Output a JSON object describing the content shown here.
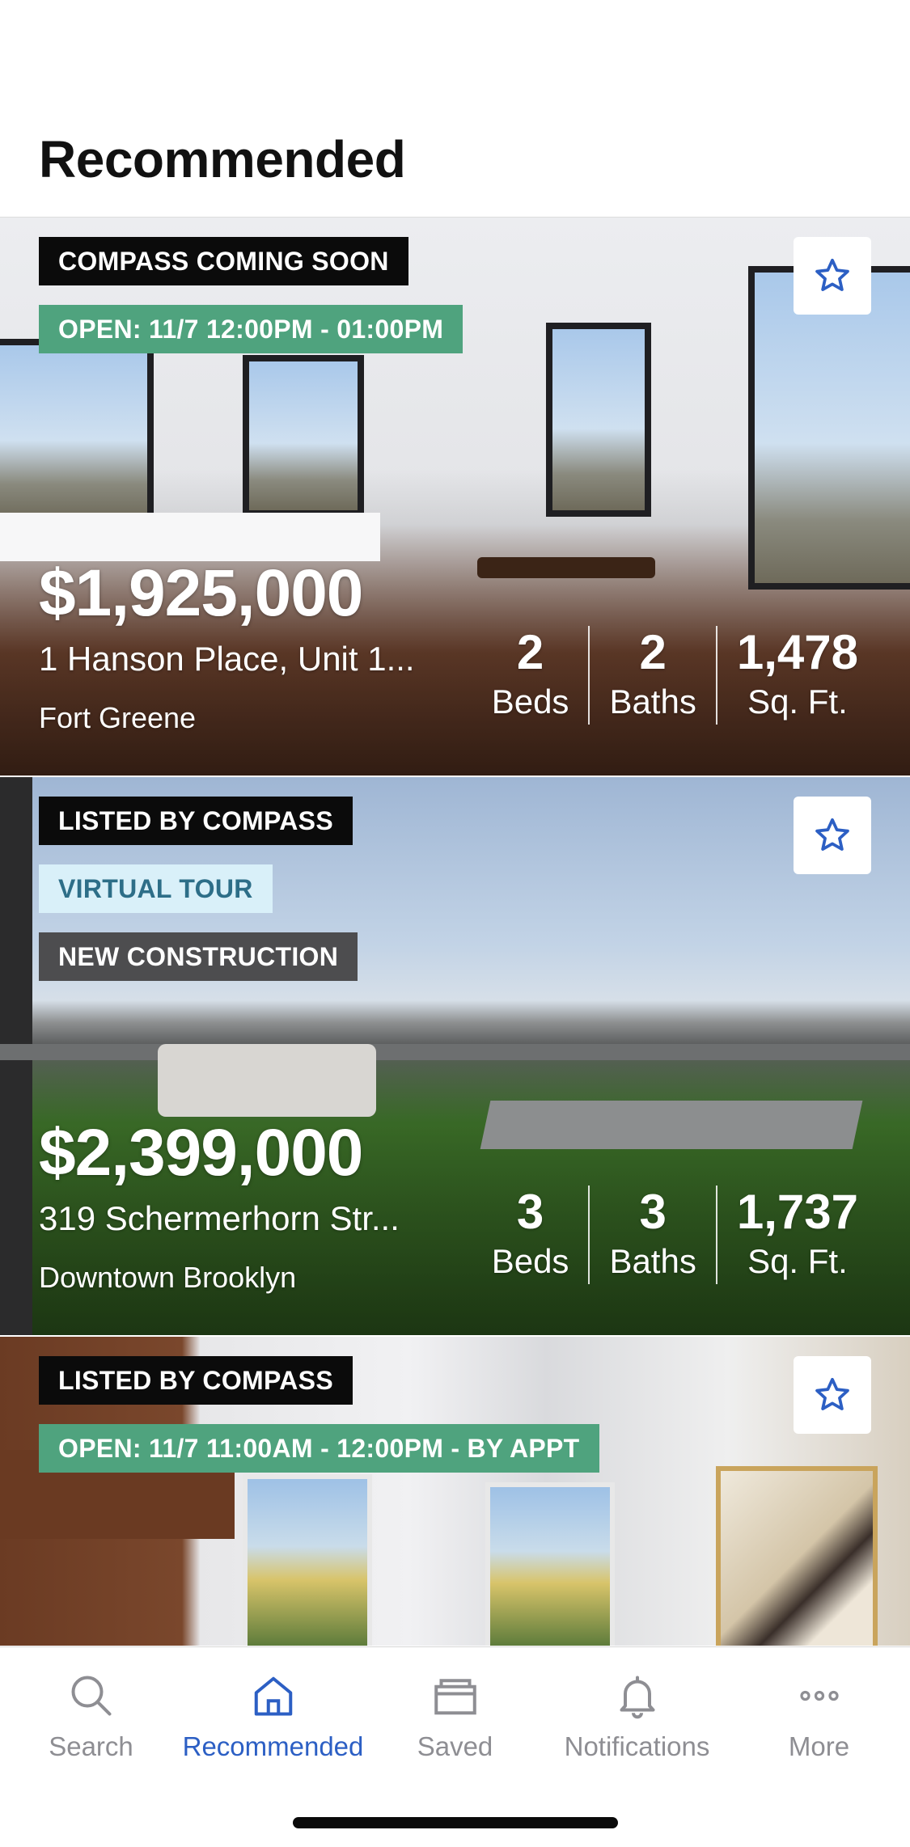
{
  "page": {
    "title": "Recommended"
  },
  "listings": [
    {
      "tags": [
        {
          "text": "COMPASS COMING SOON",
          "style": "black"
        },
        {
          "text": "OPEN: 11/7 12:00PM - 01:00PM",
          "style": "green"
        }
      ],
      "price": "$1,925,000",
      "address": "1 Hanson Place, Unit 1...",
      "neighborhood": "Fort Greene",
      "beds": "2",
      "beds_label": "Beds",
      "baths": "2",
      "baths_label": "Baths",
      "sqft": "1,478",
      "sqft_label": "Sq. Ft.",
      "favorite_icon": "star-outline-icon"
    },
    {
      "tags": [
        {
          "text": "LISTED BY COMPASS",
          "style": "black"
        },
        {
          "text": "VIRTUAL TOUR",
          "style": "lightblue"
        },
        {
          "text": "NEW CONSTRUCTION",
          "style": "grey"
        }
      ],
      "price": "$2,399,000",
      "address": "319 Schermerhorn Str...",
      "neighborhood": "Downtown Brooklyn",
      "beds": "3",
      "beds_label": "Beds",
      "baths": "3",
      "baths_label": "Baths",
      "sqft": "1,737",
      "sqft_label": "Sq. Ft.",
      "favorite_icon": "star-outline-icon"
    },
    {
      "tags": [
        {
          "text": "LISTED BY COMPASS",
          "style": "black"
        },
        {
          "text": "OPEN: 11/7 11:00AM - 12:00PM - BY APPT",
          "style": "green"
        }
      ],
      "favorite_icon": "star-outline-icon"
    }
  ],
  "tabbar": {
    "items": [
      {
        "label": "Search",
        "icon": "search-icon",
        "active": false
      },
      {
        "label": "Recommended",
        "icon": "home-icon",
        "active": true
      },
      {
        "label": "Saved",
        "icon": "folder-icon",
        "active": false
      },
      {
        "label": "Notifications",
        "icon": "bell-icon",
        "active": false
      },
      {
        "label": "More",
        "icon": "more-icon",
        "active": false
      }
    ]
  },
  "colors": {
    "accent_blue": "#2c5fc4",
    "tag_green": "#4fa37e",
    "tag_black": "#0b0b0b",
    "tag_lightblue": "#d9f0f9",
    "tag_grey": "#4d4d4f",
    "inactive_tab": "#8e8e93"
  }
}
